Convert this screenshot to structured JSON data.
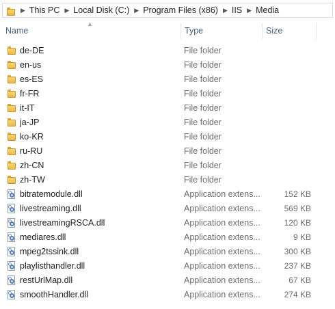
{
  "breadcrumb": [
    "This PC",
    "Local Disk (C:)",
    "Program Files (x86)",
    "IIS",
    "Media"
  ],
  "columns": {
    "name": "Name",
    "type": "Type",
    "size": "Size"
  },
  "rows": [
    {
      "name": "de-DE",
      "type": "File folder",
      "size": "",
      "kind": "folder"
    },
    {
      "name": "en-us",
      "type": "File folder",
      "size": "",
      "kind": "folder"
    },
    {
      "name": "es-ES",
      "type": "File folder",
      "size": "",
      "kind": "folder"
    },
    {
      "name": "fr-FR",
      "type": "File folder",
      "size": "",
      "kind": "folder"
    },
    {
      "name": "it-IT",
      "type": "File folder",
      "size": "",
      "kind": "folder"
    },
    {
      "name": "ja-JP",
      "type": "File folder",
      "size": "",
      "kind": "folder"
    },
    {
      "name": "ko-KR",
      "type": "File folder",
      "size": "",
      "kind": "folder"
    },
    {
      "name": "ru-RU",
      "type": "File folder",
      "size": "",
      "kind": "folder"
    },
    {
      "name": "zh-CN",
      "type": "File folder",
      "size": "",
      "kind": "folder"
    },
    {
      "name": "zh-TW",
      "type": "File folder",
      "size": "",
      "kind": "folder"
    },
    {
      "name": "bitratemodule.dll",
      "type": "Application extens...",
      "size": "152 KB",
      "kind": "dll"
    },
    {
      "name": "livestreaming.dll",
      "type": "Application extens...",
      "size": "569 KB",
      "kind": "dll"
    },
    {
      "name": "livestreamingRSCA.dll",
      "type": "Application extens...",
      "size": "120 KB",
      "kind": "dll"
    },
    {
      "name": "mediares.dll",
      "type": "Application extens...",
      "size": "9 KB",
      "kind": "dll"
    },
    {
      "name": "mpeg2tssink.dll",
      "type": "Application extens...",
      "size": "300 KB",
      "kind": "dll"
    },
    {
      "name": "playlisthandler.dll",
      "type": "Application extens...",
      "size": "237 KB",
      "kind": "dll"
    },
    {
      "name": "restUrlMap.dll",
      "type": "Application extens...",
      "size": "67 KB",
      "kind": "dll"
    },
    {
      "name": "smoothHandler.dll",
      "type": "Application extens...",
      "size": "274 KB",
      "kind": "dll"
    }
  ],
  "icons": {
    "folder": "folder-icon",
    "dll": "dll-file-icon",
    "separator": "chevron-right-icon",
    "sort": "sort-ascending-icon"
  },
  "colors": {
    "header_text": "#4c607a",
    "folder": "#f0c65a",
    "dll_gear": "#5b7fb4"
  }
}
